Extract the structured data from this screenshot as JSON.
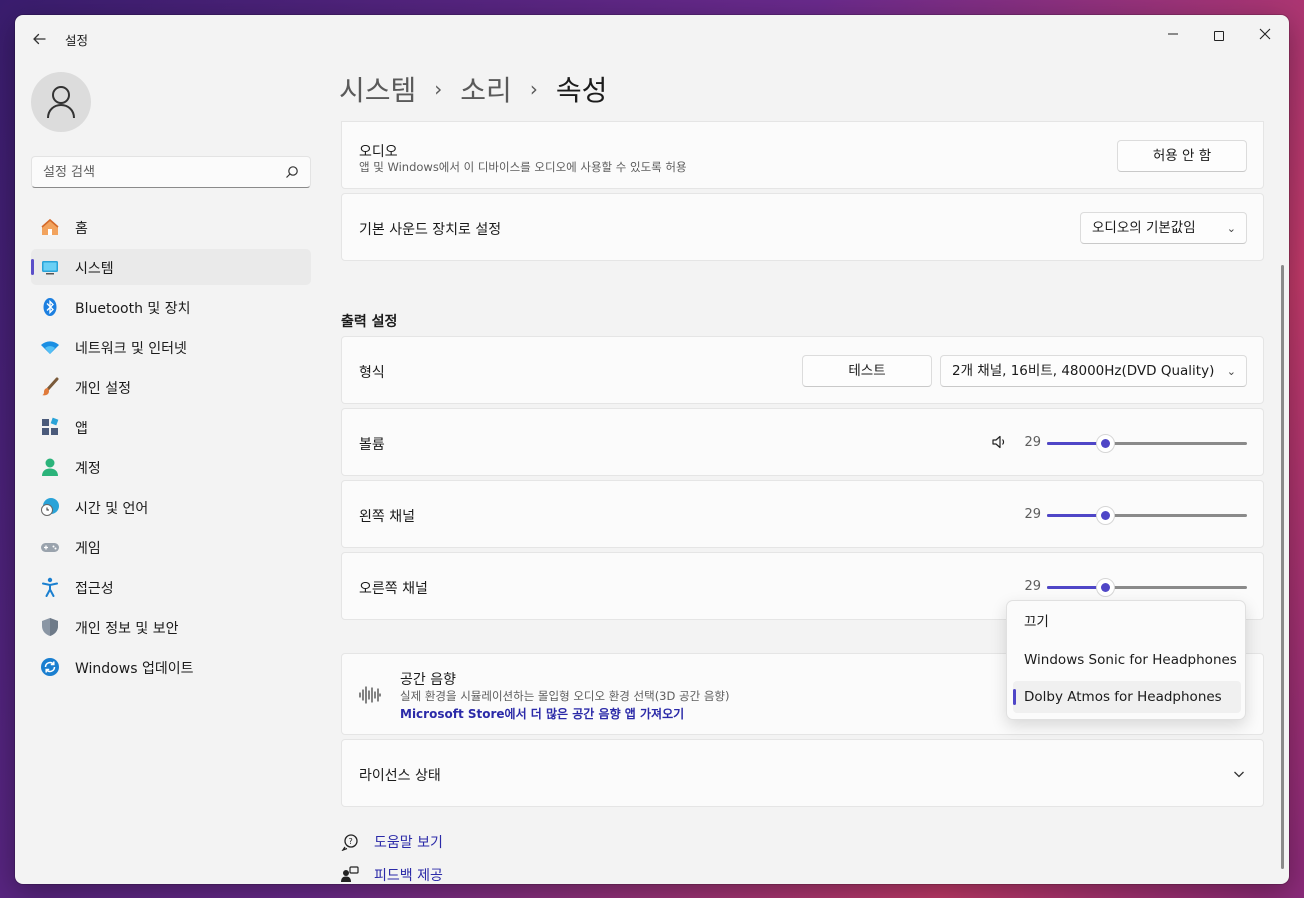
{
  "window": {
    "title": "설정"
  },
  "search": {
    "placeholder": "설정 검색"
  },
  "sidebar": {
    "items": [
      {
        "label": "홈",
        "icon": "home-icon"
      },
      {
        "label": "시스템",
        "icon": "system-icon",
        "active": true
      },
      {
        "label": "Bluetooth 및 장치",
        "icon": "bluetooth-icon"
      },
      {
        "label": "네트워크 및 인터넷",
        "icon": "wifi-icon"
      },
      {
        "label": "개인 설정",
        "icon": "brush-icon"
      },
      {
        "label": "앱",
        "icon": "apps-icon"
      },
      {
        "label": "계정",
        "icon": "account-icon"
      },
      {
        "label": "시간 및 언어",
        "icon": "clock-globe-icon"
      },
      {
        "label": "게임",
        "icon": "gamepad-icon"
      },
      {
        "label": "접근성",
        "icon": "accessibility-icon"
      },
      {
        "label": "개인 정보 및 보안",
        "icon": "shield-icon"
      },
      {
        "label": "Windows 업데이트",
        "icon": "update-icon"
      }
    ]
  },
  "breadcrumb": {
    "level1": "시스템",
    "level2": "소리",
    "level3": "속성",
    "separator": "›"
  },
  "audio": {
    "title": "오디오",
    "description": "앱 및 Windows에서 이 디바이스를 오디오에 사용할 수 있도록 허용",
    "button": "허용 안 함"
  },
  "default_device": {
    "label": "기본 사운드 장치로 설정",
    "value": "오디오의 기본값임"
  },
  "output": {
    "section_title": "출력 설정",
    "format_label": "형식",
    "test_button": "테스트",
    "format_value": "2개 채널, 16비트, 48000Hz(DVD Quality)",
    "volume": {
      "label": "볼륨",
      "value": "29",
      "fraction": 0.29
    },
    "left": {
      "label": "왼쪽 채널",
      "value": "29",
      "fraction": 0.29
    },
    "right": {
      "label": "오른쪽 채널",
      "value": "29",
      "fraction": 0.29
    }
  },
  "spatial": {
    "title": "공간 음향",
    "description": "실제 환경을 시뮬레이션하는 몰입형 오디오 환경 선택(3D 공간 음향)",
    "link": "Microsoft Store에서 더 많은 공간 음향 앱 가져오기",
    "options": [
      "끄기",
      "Windows Sonic for Headphones",
      "Dolby Atmos for Headphones"
    ],
    "selected": "Dolby Atmos for Headphones"
  },
  "license": {
    "label": "라이선스 상태"
  },
  "footer": {
    "help": "도움말 보기",
    "feedback": "피드백 제공"
  },
  "colors": {
    "accent": "#4f46c7",
    "link": "#2b2aa8"
  }
}
